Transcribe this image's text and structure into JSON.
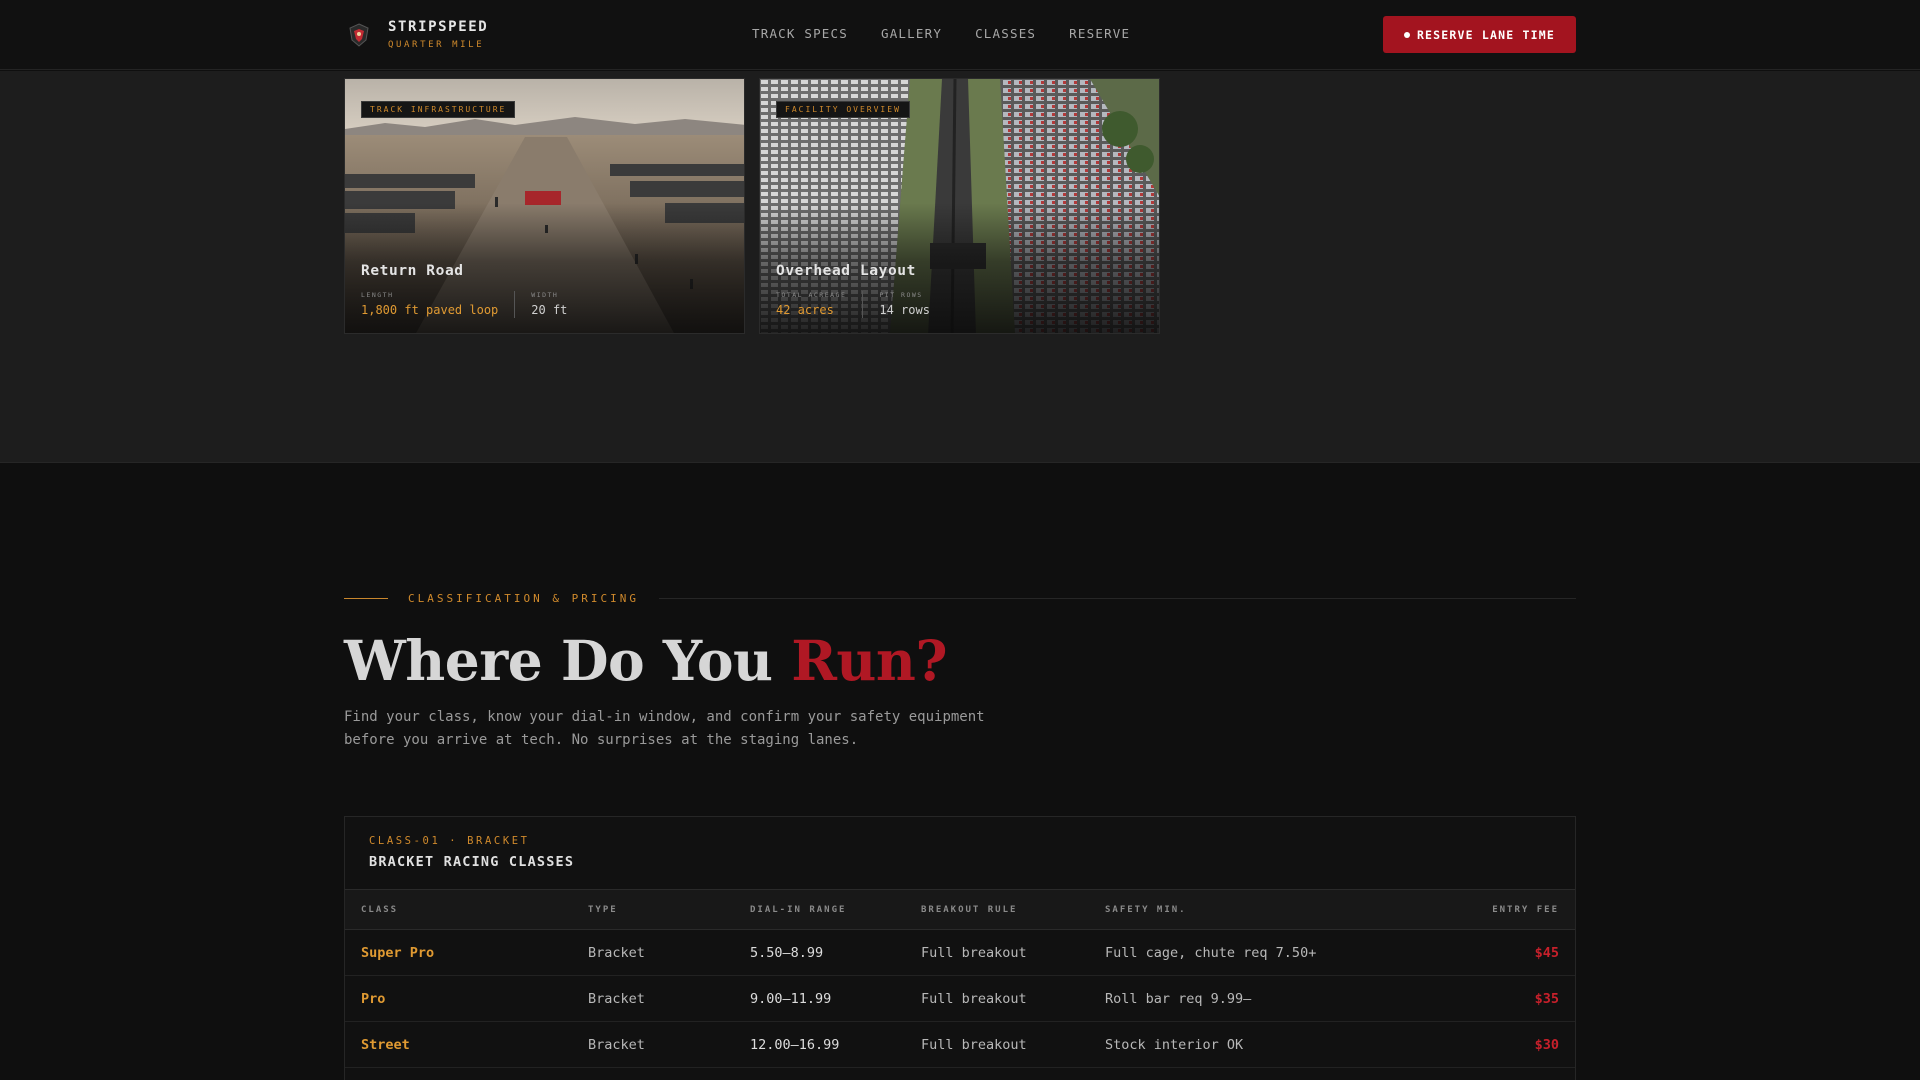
{
  "brand": {
    "name": "STRIPSPEED",
    "tagline": "QUARTER MILE"
  },
  "nav": {
    "items": [
      "TRACK SPECS",
      "GALLERY",
      "CLASSES",
      "RESERVE"
    ]
  },
  "cta": {
    "label": "RESERVE LANE TIME"
  },
  "gallery": {
    "cards": [
      {
        "tag": "TRACK INFRASTRUCTURE",
        "title": "Return Road",
        "stats": [
          {
            "label": "LENGTH",
            "value": "1,800 ft paved loop"
          },
          {
            "label": "WIDTH",
            "value": "20 ft"
          }
        ]
      },
      {
        "tag": "FACILITY OVERVIEW",
        "title": "Overhead Layout",
        "stats": [
          {
            "label": "TOTAL ACREAGE",
            "value": "42 acres"
          },
          {
            "label": "PIT ROWS",
            "value": "14 rows"
          }
        ]
      }
    ]
  },
  "classes": {
    "eyebrow": "CLASSIFICATION & PRICING",
    "headline_main": "Where Do You ",
    "headline_accent": "Run?",
    "lede": "Find your class, know your dial-in window, and confirm your safety equipment before you arrive at tech. No surprises at the staging lanes.",
    "table": {
      "kicker": "CLASS-01 · BRACKET",
      "title": "BRACKET RACING CLASSES",
      "columns": [
        "CLASS",
        "TYPE",
        "DIAL-IN RANGE",
        "BREAKOUT RULE",
        "SAFETY MIN.",
        "ENTRY FEE"
      ],
      "rows": [
        {
          "class": "Super Pro",
          "type": "Bracket",
          "dial": "5.50–8.99",
          "rule": "Full breakout",
          "safety": "Full cage, chute req 7.50+",
          "fee": "$45"
        },
        {
          "class": "Pro",
          "type": "Bracket",
          "dial": "9.00–11.99",
          "rule": "Full breakout",
          "safety": "Roll bar req 9.99–",
          "fee": "$35"
        },
        {
          "class": "Street",
          "type": "Bracket",
          "dial": "12.00–16.99",
          "rule": "Full breakout",
          "safety": "Stock interior OK",
          "fee": "$30"
        }
      ]
    }
  },
  "colors": {
    "accent_red": "#a3141f",
    "accent_orange": "#d08a2c",
    "background": "#0f0f0f"
  },
  "icons": {
    "brand": "shield-logo-icon",
    "cta": "dot-icon"
  }
}
